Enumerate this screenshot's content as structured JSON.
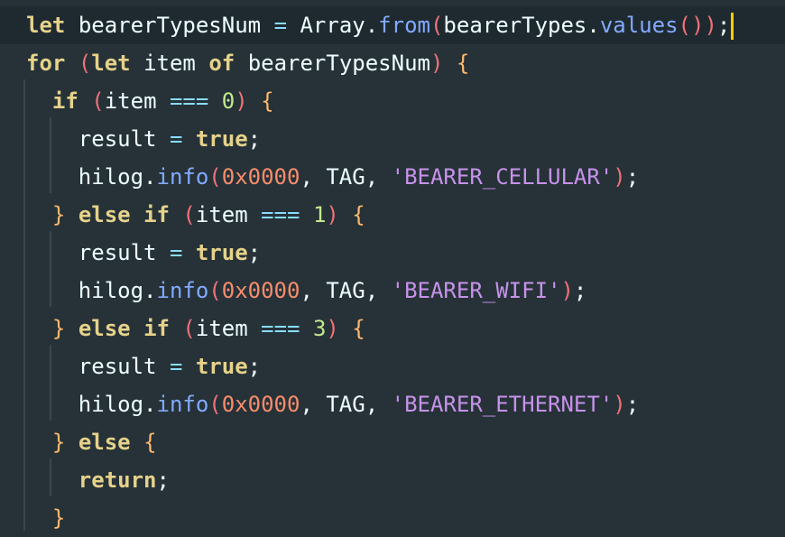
{
  "editor": {
    "lines": [
      "let bearerTypesNum = Array.from(bearerTypes.values());",
      "for (let item of bearerTypesNum) {",
      "  if (item === 0) {",
      "    result = true;",
      "    hilog.info(0x0000, TAG, 'BEARER_CELLULAR');",
      "  } else if (item === 1) {",
      "    result = true;",
      "    hilog.info(0x0000, TAG, 'BEARER_WIFI');",
      "  } else if (item === 3) {",
      "    result = true;",
      "    hilog.info(0x0000, TAG, 'BEARER_ETHERNET');",
      "  } else {",
      "    return;",
      "  }"
    ],
    "colors": {
      "background": "#263238",
      "current_line": "#1f2a30",
      "caret": "#ffcc00",
      "keyword": "#e6d28a",
      "identifier": "#eeffff",
      "number": "#c3e88d",
      "hex_number": "#f78c6c",
      "string": "#c792ea",
      "function": "#82aaff",
      "paren": "#f07178",
      "brace": "#ffb86c",
      "operator": "#89ddff"
    }
  }
}
